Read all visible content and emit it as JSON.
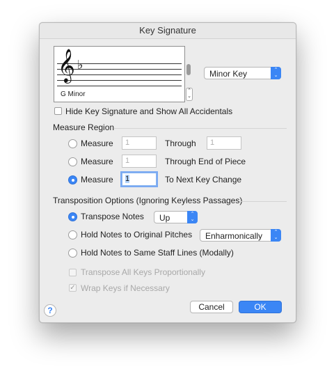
{
  "window": {
    "title": "Key Signature"
  },
  "preview": {
    "clef_glyph": "𝄞",
    "flat_glyph": "♭",
    "caption": "G Minor"
  },
  "mode_popup": {
    "value": "Minor Key"
  },
  "hide_key_checkbox": {
    "label": "Hide Key Signature and Show All Accidentals",
    "checked": false
  },
  "measure_region": {
    "title": "Measure Region",
    "option1": {
      "label": "Measure",
      "from": "1",
      "through_label": "Through",
      "through": "1",
      "selected": false
    },
    "option2": {
      "label": "Measure",
      "from": "1",
      "through_label": "Through End of Piece",
      "selected": false
    },
    "option3": {
      "label": "Measure",
      "from": "1",
      "through_label": "To Next Key Change",
      "selected": true
    }
  },
  "transposition": {
    "title": "Transposition Options (Ignoring Keyless Passages)",
    "transpose_notes": {
      "label": "Transpose Notes",
      "direction": "Up",
      "selected": true
    },
    "hold_original": {
      "label": "Hold Notes to Original Pitches",
      "method": "Enharmonically",
      "selected": false
    },
    "hold_staff_lines": {
      "label": "Hold Notes to Same Staff Lines (Modally)",
      "selected": false
    },
    "transpose_all_keys": {
      "label": "Transpose All Keys Proportionally",
      "checked": false,
      "enabled": false
    },
    "wrap_keys": {
      "label": "Wrap Keys if Necessary",
      "checked": true,
      "enabled": false,
      "check_glyph": "✓"
    }
  },
  "buttons": {
    "help": "?",
    "cancel": "Cancel",
    "ok": "OK"
  },
  "colors": {
    "accent": "#3b86f5",
    "dialog_bg": "#ececec"
  },
  "icons": {
    "popup_arrows": "⌃⌄"
  }
}
